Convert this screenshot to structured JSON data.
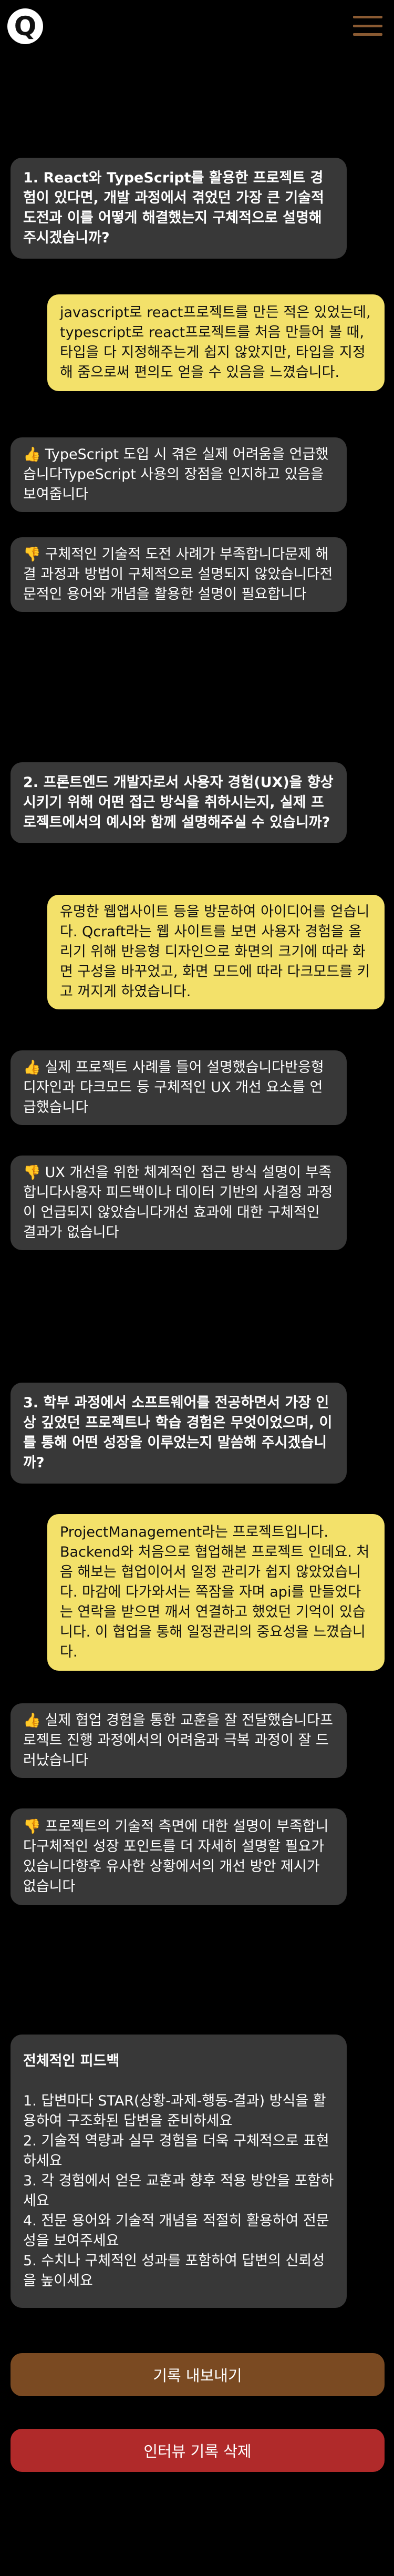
{
  "app": {
    "logo_letter": "Q"
  },
  "colors": {
    "accent": "#7a4a22",
    "danger": "#b02a2a",
    "answer_bg": "#f3e16a",
    "bubble_bg": "#383838"
  },
  "icons": {
    "menu": "hamburger-icon",
    "thumbs_up": "thumbs-up-icon",
    "thumbs_down": "thumbs-down-icon"
  },
  "qa": [
    {
      "question": "1. React와 TypeScript를 활용한 프로젝트 경험이 있다면, 개발 과정에서 겪었던 가장 큰 기술적 도전과 이를 어떻게 해결했는지 구체적으로 설명해주시겠습니까?",
      "answer": "javascript로 react프로젝트를 만든 적은 있었는데, typescript로 react프로젝트를 처음 만들어 볼 때, 타입을 다 지정해주는게 쉽지 않았지만, 타입을 지정해 줌으로써 편의도 얻을 수 있음을 느꼈습니다.",
      "good": "TypeScript 도입 시 겪은 실제 어려움을 언급했습니다TypeScript 사용의 장점을 인지하고 있음을 보여줍니다",
      "bad": "구체적인 기술적 도전 사례가 부족합니다문제 해결 과정과 방법이 구체적으로 설명되지 않았습니다전문적인 용어와 개념을 활용한 설명이 필요합니다"
    },
    {
      "question": "2. 프론트엔드 개발자로서 사용자 경험(UX)을 향상시키기 위해 어떤 접근 방식을 취하시는지, 실제 프로젝트에서의 예시와 함께 설명해주실 수 있습니까?",
      "answer": "유명한 웹앱사이트 등을 방문하여 아이디어를 얻습니다. Qcraft라는 웹 사이트를 보면 사용자 경험을 올리기 위해 반응형 디자인으로 화면의 크기에 따라 화면 구성을 바꾸었고, 화면 모드에 따라 다크모드를 키고 꺼지게 하였습니다.",
      "good": "실제 프로젝트 사례를 들어 설명했습니다반응형 디자인과 다크모드 등 구체적인 UX 개선 요소를 언급했습니다",
      "bad": "UX 개선을 위한 체계적인 접근 방식 설명이 부족합니다사용자 피드백이나 데이터 기반의 사결정 과정이 언급되지 않았습니다개선 효과에 대한 구체적인 결과가 없습니다"
    },
    {
      "question": "3. 학부 과정에서 소프트웨어를 전공하면서 가장 인상 깊었던 프로젝트나 학습 경험은 무엇이었으며, 이를 통해 어떤 성장을 이루었는지 말씀해 주시겠습니까?",
      "answer": "ProjectManagement라는 프로젝트입니다. Backend와 처음으로 협업해본 프로젝트 인데요. 처음 해보는 협업이어서 일정 관리가 쉽지 않았었습니다. 마감에 다가와서는 쪽잠을 자며 api를 만들었다는 연락을 받으면 깨서 연결하고 했었던 기억이 있습니다. 이 협업을 통해 일정관리의 중요성을 느꼈습니다.",
      "good": "실제 협업 경험을 통한 교훈을 잘 전달했습니다프로젝트 진행 과정에서의 어려움과 극복 과정이 잘 드러났습니다",
      "bad": "프로젝트의 기술적 측면에 대한 설명이 부족합니다구체적인 성장 포인트를 더 자세히 설명할 필요가 있습니다향후 유사한 상황에서의 개선 방안 제시가 없습니다"
    }
  ],
  "summary": {
    "title": "전체적인 피드백",
    "items": [
      "1. 답변마다 STAR(상황-과제-행동-결과) 방식을 활용하여 구조화된 답변을 준비하세요",
      "2. 기술적 역량과 실무 경험을 더욱 구체적으로 표현하세요",
      "3. 각 경험에서 얻은 교훈과 향후 적용 방안을 포함하세요",
      "4. 전문 용어와 기술적 개념을 적절히 활용하여 전문성을 보여주세요",
      "5. 수치나 구체적인 성과를 포함하여 답변의 신뢰성을 높이세요"
    ]
  },
  "buttons": {
    "export_label": "기록 내보내기",
    "delete_label": "인터뷰 기록 삭제"
  }
}
